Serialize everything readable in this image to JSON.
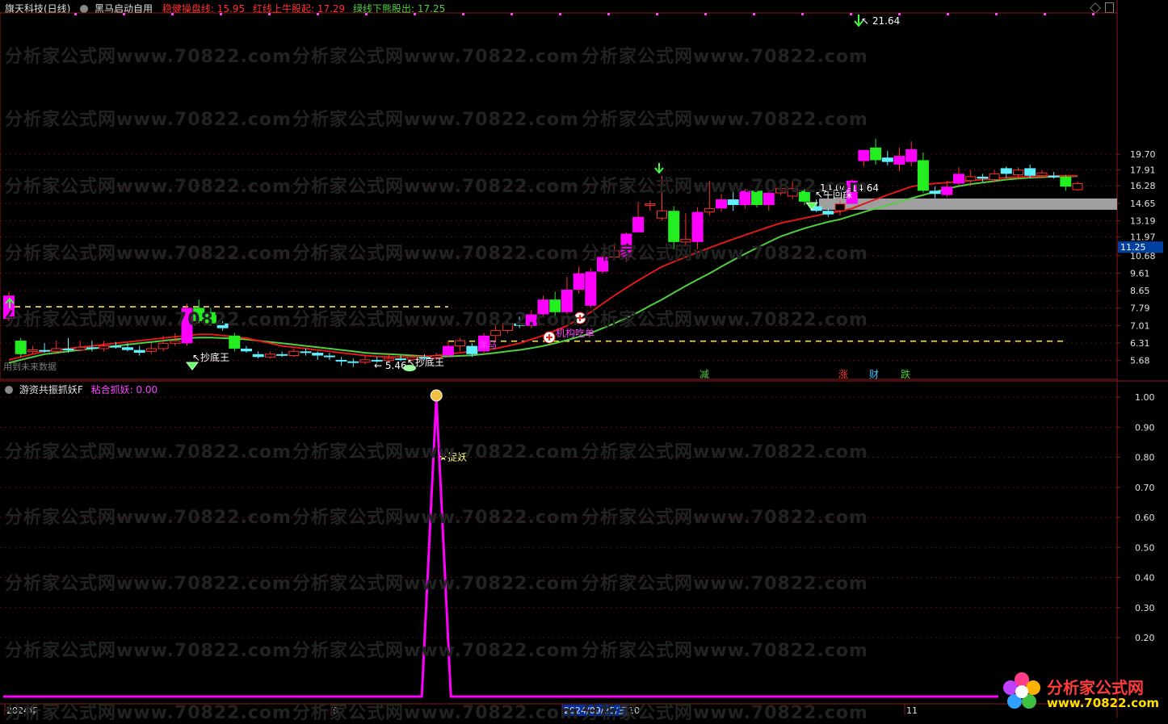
{
  "header": {
    "stock": "旗天科技(日线)",
    "indicator": "黑马启动自用",
    "line1_label": "稳健操盘线:",
    "line1_value": "15.95",
    "line2_label": "红线上牛股起:",
    "line2_value": "17.29",
    "line3_label": "绿线下熊股出:",
    "line3_value": "17.25"
  },
  "sub_header": {
    "title": "游资共振抓妖F",
    "label": "粘合抓妖:",
    "value": "0.00"
  },
  "notice": "用到未来数据",
  "watermark": "分析家公式网www.70822.com",
  "logo": {
    "name": "分析家公式网",
    "url": "www.70822.com"
  },
  "colors": {
    "bg": "#000000",
    "up": "#ff00ff",
    "up_small": "#ff3030",
    "down": "#22ee22",
    "down_small": "#60f0ff",
    "red_line": "#e01818",
    "green_line": "#50d040",
    "dash_line": "#f0e060",
    "axis": "#8b1a1a",
    "sub_line": "#ff00ff",
    "gray_band": "#a0a0a0"
  },
  "chart_data": [
    {
      "type": "candlestick",
      "price_labels": [
        "19.70",
        "17.91",
        "16.28",
        "14.65",
        "13.19",
        "11.97",
        "10.68",
        "9.61",
        "8.65",
        "7.79",
        "7.01",
        "6.31",
        "5.68"
      ],
      "current_price": "11.25",
      "x_labels": [
        "2024年",
        "9",
        "2024/09/25/三",
        "10",
        "11"
      ],
      "annotations": {
        "high": "21.64",
        "low": "5.46",
        "support_low": "14.04",
        "support_high": "14.64",
        "bottom_signal": "抄底王",
        "bull_signal": "牛回踩",
        "inst_signal": "机构吃单",
        "hidden_label": "黑马",
        "markers": [
          "减",
          "涨",
          "财",
          "跌"
        ]
      },
      "candles": [
        {
          "o": 7.3,
          "c": 8.4,
          "h": 8.6,
          "l": 7.2
        },
        {
          "o": 6.4,
          "c": 5.9,
          "h": 6.5,
          "l": 5.8
        },
        {
          "o": 6.0,
          "c": 6.05,
          "h": 6.2,
          "l": 5.9
        },
        {
          "o": 6.05,
          "c": 6.0,
          "h": 6.3,
          "l": 5.95
        },
        {
          "o": 6.0,
          "c": 6.1,
          "h": 6.4,
          "l": 5.9
        },
        {
          "o": 6.1,
          "c": 6.05,
          "h": 6.5,
          "l": 5.95
        },
        {
          "o": 6.05,
          "c": 6.15,
          "h": 6.4,
          "l": 6.0
        },
        {
          "o": 6.15,
          "c": 6.1,
          "h": 6.4,
          "l": 6.0
        },
        {
          "o": 6.1,
          "c": 6.2,
          "h": 6.4,
          "l": 6.0
        },
        {
          "o": 6.2,
          "c": 6.15,
          "h": 6.35,
          "l": 6.1
        },
        {
          "o": 6.15,
          "c": 6.05,
          "h": 6.3,
          "l": 6.0
        },
        {
          "o": 6.05,
          "c": 5.95,
          "h": 6.2,
          "l": 5.85
        },
        {
          "o": 6.0,
          "c": 6.1,
          "h": 6.3,
          "l": 5.9
        },
        {
          "o": 6.1,
          "c": 6.3,
          "h": 6.6,
          "l": 6.0
        },
        {
          "o": 6.3,
          "c": 6.4,
          "h": 6.7,
          "l": 6.2
        },
        {
          "o": 6.3,
          "c": 7.8,
          "h": 8.0,
          "l": 6.2
        },
        {
          "o": 7.8,
          "c": 7.2,
          "h": 8.2,
          "l": 7.1
        },
        {
          "o": 7.6,
          "c": 7.1,
          "h": 7.8,
          "l": 7.0
        },
        {
          "o": 7.1,
          "c": 6.9,
          "h": 7.2,
          "l": 6.8
        },
        {
          "o": 6.6,
          "c": 6.1,
          "h": 6.7,
          "l": 6.0
        },
        {
          "o": 6.1,
          "c": 6.0,
          "h": 6.2,
          "l": 5.95
        },
        {
          "o": 5.9,
          "c": 5.8,
          "h": 6.0,
          "l": 5.75
        },
        {
          "o": 5.8,
          "c": 5.9,
          "h": 6.0,
          "l": 5.75
        },
        {
          "o": 5.9,
          "c": 5.85,
          "h": 6.0,
          "l": 5.8
        },
        {
          "o": 5.85,
          "c": 6.0,
          "h": 6.1,
          "l": 5.8
        },
        {
          "o": 6.0,
          "c": 5.95,
          "h": 6.1,
          "l": 5.85
        },
        {
          "o": 5.95,
          "c": 5.85,
          "h": 6.0,
          "l": 5.7
        },
        {
          "o": 5.85,
          "c": 5.8,
          "h": 5.95,
          "l": 5.7
        },
        {
          "o": 5.7,
          "c": 5.65,
          "h": 5.8,
          "l": 5.5
        },
        {
          "o": 5.65,
          "c": 5.62,
          "h": 5.75,
          "l": 5.46
        },
        {
          "o": 5.62,
          "c": 5.7,
          "h": 5.85,
          "l": 5.55
        },
        {
          "o": 5.7,
          "c": 5.68,
          "h": 5.8,
          "l": 5.6
        },
        {
          "o": 5.68,
          "c": 5.75,
          "h": 5.9,
          "l": 5.6
        },
        {
          "o": 5.75,
          "c": 5.72,
          "h": 5.85,
          "l": 5.65
        },
        {
          "o": 5.72,
          "c": 5.8,
          "h": 5.9,
          "l": 5.65
        },
        {
          "o": 5.8,
          "c": 5.78,
          "h": 5.9,
          "l": 5.7
        },
        {
          "o": 5.78,
          "c": 5.85,
          "h": 5.95,
          "l": 5.7
        },
        {
          "o": 5.85,
          "c": 6.2,
          "h": 6.4,
          "l": 5.8
        },
        {
          "o": 6.2,
          "c": 6.4,
          "h": 6.5,
          "l": 6.0
        },
        {
          "o": 6.2,
          "c": 5.9,
          "h": 6.3,
          "l": 5.8
        },
        {
          "o": 6.0,
          "c": 6.6,
          "h": 6.7,
          "l": 5.9
        },
        {
          "o": 6.6,
          "c": 6.8,
          "h": 7.0,
          "l": 6.4
        },
        {
          "o": 6.8,
          "c": 7.1,
          "h": 7.3,
          "l": 6.7
        },
        {
          "o": 7.1,
          "c": 7.0,
          "h": 7.4,
          "l": 6.9
        },
        {
          "o": 7.0,
          "c": 7.5,
          "h": 7.7,
          "l": 6.9
        },
        {
          "o": 7.5,
          "c": 8.2,
          "h": 8.4,
          "l": 7.4
        },
        {
          "o": 8.2,
          "c": 7.6,
          "h": 8.6,
          "l": 7.4
        },
        {
          "o": 7.6,
          "c": 8.7,
          "h": 9.4,
          "l": 7.5
        },
        {
          "o": 8.7,
          "c": 9.6,
          "h": 10.0,
          "l": 8.5
        },
        {
          "o": 7.9,
          "c": 9.7,
          "h": 9.9,
          "l": 7.8
        },
        {
          "o": 9.7,
          "c": 10.6,
          "h": 10.9,
          "l": 9.6
        },
        {
          "o": 10.6,
          "c": 11.0,
          "h": 11.5,
          "l": 10.4
        },
        {
          "o": 10.6,
          "c": 12.2,
          "h": 12.3,
          "l": 10.3
        },
        {
          "o": 12.3,
          "c": 13.5,
          "h": 14.8,
          "l": 12.3
        },
        {
          "o": 14.5,
          "c": 14.6,
          "h": 14.9,
          "l": 14.0
        },
        {
          "o": 13.4,
          "c": 14.0,
          "h": 17.3,
          "l": 13.2
        },
        {
          "o": 14.0,
          "c": 11.6,
          "h": 14.4,
          "l": 11.1
        },
        {
          "o": 11.6,
          "c": 11.8,
          "h": 13.8,
          "l": 11.4
        },
        {
          "o": 11.6,
          "c": 13.9,
          "h": 14.3,
          "l": 11.1
        },
        {
          "o": 13.9,
          "c": 14.2,
          "h": 16.8,
          "l": 13.6
        },
        {
          "o": 14.2,
          "c": 15.0,
          "h": 15.5,
          "l": 13.9
        },
        {
          "o": 15.0,
          "c": 14.5,
          "h": 15.7,
          "l": 14.0
        },
        {
          "o": 14.5,
          "c": 15.8,
          "h": 16.0,
          "l": 14.2
        },
        {
          "o": 15.8,
          "c": 14.5,
          "h": 16.0,
          "l": 14.3
        },
        {
          "o": 14.5,
          "c": 15.6,
          "h": 16.0,
          "l": 14.0
        },
        {
          "o": 15.6,
          "c": 16.0,
          "h": 16.4,
          "l": 15.4
        },
        {
          "o": 15.3,
          "c": 16.0,
          "h": 16.8,
          "l": 15.0
        },
        {
          "o": 15.8,
          "c": 14.8,
          "h": 16.0,
          "l": 14.5
        },
        {
          "o": 14.4,
          "c": 14.0,
          "h": 15.0,
          "l": 13.9
        },
        {
          "o": 14.0,
          "c": 13.7,
          "h": 14.2,
          "l": 13.5
        },
        {
          "o": 14.0,
          "c": 14.6,
          "h": 14.9,
          "l": 13.6
        },
        {
          "o": 14.6,
          "c": 16.8,
          "h": 16.9,
          "l": 14.6
        },
        {
          "o": 18.9,
          "c": 20.2,
          "h": 20.2,
          "l": 18.3
        },
        {
          "o": 20.5,
          "c": 19.0,
          "h": 21.64,
          "l": 18.5
        },
        {
          "o": 19.3,
          "c": 18.8,
          "h": 20.1,
          "l": 18.4
        },
        {
          "o": 18.5,
          "c": 19.5,
          "h": 20.5,
          "l": 17.8
        },
        {
          "o": 18.8,
          "c": 20.3,
          "h": 21.3,
          "l": 18.3
        },
        {
          "o": 19.0,
          "c": 15.8,
          "h": 19.9,
          "l": 15.6
        },
        {
          "o": 15.8,
          "c": 15.5,
          "h": 16.2,
          "l": 15.1
        },
        {
          "o": 15.4,
          "c": 16.2,
          "h": 16.8,
          "l": 15.2
        },
        {
          "o": 16.5,
          "c": 17.5,
          "h": 18.2,
          "l": 16.3
        },
        {
          "o": 16.8,
          "c": 17.2,
          "h": 17.9,
          "l": 16.3
        },
        {
          "o": 17.2,
          "c": 17.0,
          "h": 17.5,
          "l": 16.7
        },
        {
          "o": 16.9,
          "c": 17.5,
          "h": 17.9,
          "l": 16.6
        },
        {
          "o": 18.1,
          "c": 17.5,
          "h": 18.3,
          "l": 17.1
        },
        {
          "o": 17.4,
          "c": 17.9,
          "h": 18.2,
          "l": 17.0
        },
        {
          "o": 18.1,
          "c": 17.3,
          "h": 18.5,
          "l": 17.0
        },
        {
          "o": 17.3,
          "c": 17.6,
          "h": 17.9,
          "l": 17.0
        },
        {
          "o": 17.3,
          "c": 17.2,
          "h": 17.7,
          "l": 17.0
        },
        {
          "o": 17.2,
          "c": 16.2,
          "h": 17.4,
          "l": 15.8
        },
        {
          "o": 15.9,
          "c": 16.5,
          "h": 16.7,
          "l": 15.8
        }
      ],
      "red_line": [
        5.7,
        5.8,
        5.9,
        6.0,
        6.05,
        6.1,
        6.15,
        6.2,
        6.25,
        6.3,
        6.35,
        6.4,
        6.45,
        6.5,
        6.55,
        6.6,
        6.65,
        6.65,
        6.6,
        6.55,
        6.5,
        6.4,
        6.3,
        6.2,
        6.15,
        6.1,
        6.05,
        6.0,
        5.95,
        5.9,
        5.85,
        5.82,
        5.8,
        5.8,
        5.8,
        5.82,
        5.85,
        5.9,
        5.95,
        6.0,
        6.05,
        6.1,
        6.2,
        6.3,
        6.45,
        6.6,
        6.8,
        7.0,
        7.3,
        7.6,
        8.0,
        8.4,
        8.8,
        9.2,
        9.6,
        10.0,
        10.3,
        10.6,
        10.9,
        11.2,
        11.5,
        11.8,
        12.1,
        12.4,
        12.7,
        13.0,
        13.2,
        13.4,
        13.6,
        13.8,
        13.95,
        14.2,
        14.6,
        15.0,
        15.4,
        15.8,
        16.2,
        16.4,
        16.5,
        16.6,
        16.7,
        16.8,
        16.9,
        17.0,
        17.1,
        17.15,
        17.2,
        17.25,
        17.28,
        17.29,
        17.29
      ],
      "green_line": [
        5.6,
        5.7,
        5.8,
        5.9,
        5.95,
        6.0,
        6.05,
        6.1,
        6.15,
        6.2,
        6.25,
        6.3,
        6.35,
        6.4,
        6.45,
        6.5,
        6.52,
        6.52,
        6.5,
        6.48,
        6.45,
        6.4,
        6.35,
        6.3,
        6.25,
        6.2,
        6.15,
        6.1,
        6.05,
        6.0,
        5.95,
        5.92,
        5.9,
        5.88,
        5.85,
        5.83,
        5.82,
        5.82,
        5.84,
        5.86,
        5.9,
        5.95,
        6.0,
        6.05,
        6.12,
        6.2,
        6.3,
        6.42,
        6.55,
        6.7,
        6.9,
        7.1,
        7.35,
        7.6,
        7.9,
        8.2,
        8.55,
        8.9,
        9.25,
        9.6,
        10.0,
        10.4,
        10.8,
        11.2,
        11.6,
        12.0,
        12.3,
        12.6,
        12.85,
        13.1,
        13.3,
        13.6,
        13.9,
        14.2,
        14.5,
        14.8,
        15.1,
        15.4,
        15.7,
        16.0,
        16.25,
        16.45,
        16.6,
        16.75,
        16.9,
        17.0,
        17.1,
        17.15,
        17.2,
        17.24,
        17.25
      ]
    },
    {
      "type": "line",
      "ylabels": [
        "1.00",
        "0.90",
        "0.80",
        "0.70",
        "0.60",
        "0.50",
        "0.40",
        "0.30",
        "0.20"
      ],
      "values": [
        0,
        0,
        0,
        0,
        0,
        0,
        0,
        0,
        0,
        0,
        0,
        0,
        0,
        0,
        0,
        0,
        0,
        0,
        0,
        0,
        0,
        0,
        0,
        0,
        0,
        0,
        0,
        0,
        0,
        0,
        0,
        0,
        0,
        0,
        0,
        0,
        0,
        0,
        0,
        0,
        0,
        0,
        0,
        0,
        0,
        0,
        0,
        0,
        0,
        0,
        0,
        0,
        0,
        0,
        0,
        0,
        0,
        0,
        0,
        0,
        0,
        0,
        0,
        0,
        0,
        0,
        0,
        0,
        0,
        0,
        0,
        0,
        0,
        0,
        0,
        0,
        0,
        0,
        0,
        0,
        0,
        0,
        0,
        0,
        0,
        0,
        0,
        0,
        0,
        0,
        0
      ],
      "spike_index": 36,
      "spike_value": 1.0,
      "signal_label": "捉妖"
    }
  ]
}
